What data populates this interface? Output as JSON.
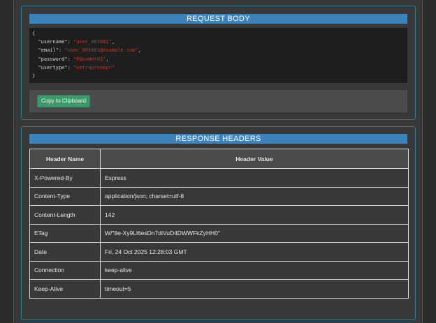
{
  "request_body": {
    "title": "REQUEST BODY",
    "open_brace": "{",
    "close_brace": "}",
    "fields": [
      {
        "key": "\"username\": ",
        "value": "\"user_001001\"",
        "comma": ","
      },
      {
        "key": "\"email\": ",
        "value": "\"user_001001@example.com\"",
        "comma": ","
      },
      {
        "key": "\"password\": ",
        "value": "\"P@ssW0rd1\"",
        "comma": ","
      },
      {
        "key": "\"usertype\": ",
        "value": "\"entrepreneur\"",
        "comma": ""
      }
    ],
    "copy_button": "Copy to Clipboard"
  },
  "response_headers": {
    "title": "RESPONSE HEADERS",
    "columns": [
      "Header Name",
      "Header Value"
    ],
    "rows": [
      [
        "X-Powered-By",
        "Express"
      ],
      [
        "Content-Type",
        "application/json; charset=utf-8"
      ],
      [
        "Content-Length",
        "142"
      ],
      [
        "ETag",
        "W/\"8e-Xy9Ll6esDn7diVuD4DWWFkZyHH0\""
      ],
      [
        "Date",
        "Fri, 24 Oct 2025 12:28:03 GMT"
      ],
      [
        "Connection",
        "keep-alive"
      ],
      [
        "Keep-Alive",
        "timeout=5"
      ]
    ]
  }
}
